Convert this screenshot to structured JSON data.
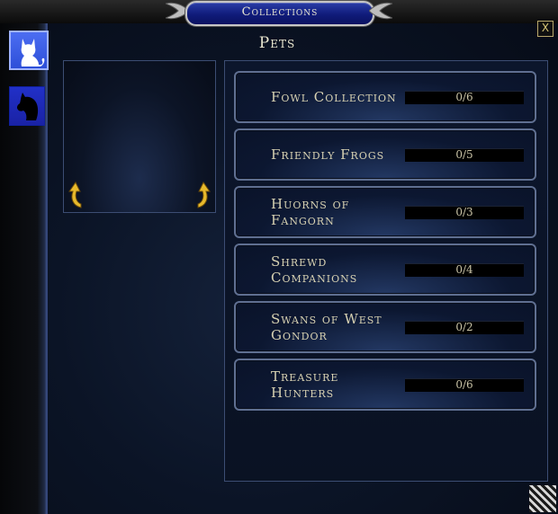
{
  "window": {
    "title": "Collections"
  },
  "close_label": "X",
  "tabs": [
    {
      "name": "pets",
      "icon": "cat-icon",
      "active": true
    },
    {
      "name": "mounts",
      "icon": "horse-icon",
      "active": false
    }
  ],
  "section": {
    "heading": "Pets"
  },
  "collections": [
    {
      "name": "Fowl Collection",
      "count": "0/6",
      "progress": 0
    },
    {
      "name": "Friendly Frogs",
      "count": "0/5",
      "progress": 0
    },
    {
      "name": "Huorns of Fangorn",
      "count": "0/3",
      "progress": 0
    },
    {
      "name": "Shrewd Companions",
      "count": "0/4",
      "progress": 0
    },
    {
      "name": "Swans of West Gondor",
      "count": "0/2",
      "progress": 0
    },
    {
      "name": "Treasure Hunters",
      "count": "0/6",
      "progress": 0
    }
  ],
  "colors": {
    "accent": "#2d4fd8",
    "text": "#d7d1b2",
    "gold": "#d8b23a"
  }
}
